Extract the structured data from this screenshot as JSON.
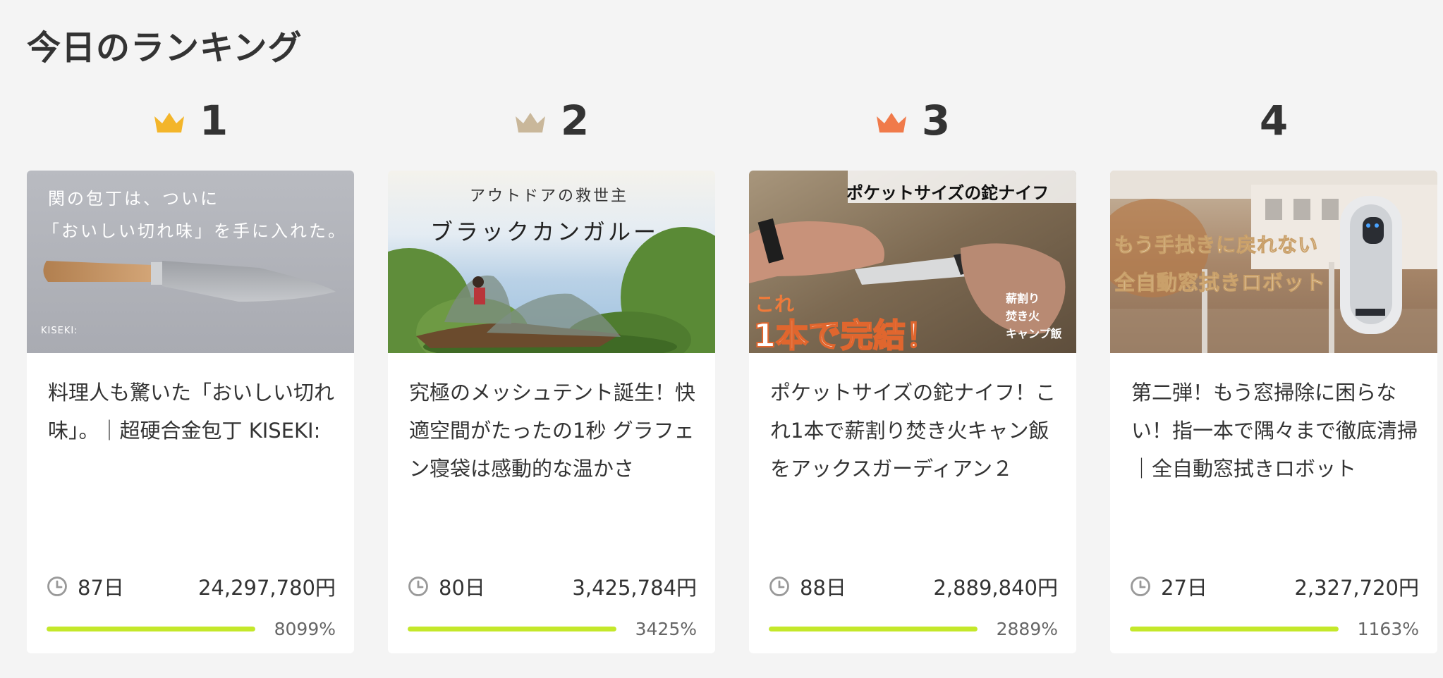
{
  "section_title": "今日のランキング",
  "colors": {
    "gold": "#f3b52a",
    "silver": "#c9b79a",
    "bronze": "#f07a4a",
    "progress": "#c4e82a"
  },
  "rankings": [
    {
      "rank": "1",
      "crown_color": "#f3b52a",
      "thumb": {
        "line1": "関の包丁は、ついに",
        "line2": "「おいしい切れ味」を手に入れた。",
        "brand": "KISEKI:"
      },
      "title": "料理人も驚いた「おいしい切れ味」。｜超硬合金包丁 KISEKI:",
      "days": "87日",
      "amount": "24,297,780円",
      "percent": "8099%",
      "progress_fraction": 1.0
    },
    {
      "rank": "2",
      "crown_color": "#c9b79a",
      "thumb": {
        "line1": "アウトドアの救世主",
        "line2": "ブラックカンガルー"
      },
      "title": "究極のメッシュテント誕生！快適空間がたったの1秒 グラフェン寝袋は感動的な温かさ",
      "days": "80日",
      "amount": "3,425,784円",
      "percent": "3425%",
      "progress_fraction": 1.0
    },
    {
      "rank": "3",
      "crown_color": "#f07a4a",
      "thumb": {
        "line1": "ポケットサイズの鉈ナイフ",
        "line2": "これ",
        "line3": "1本で完結！",
        "side1": "薪割り",
        "side2": "焚き火",
        "side3": "キャンプ飯"
      },
      "title": "ポケットサイズの鉈ナイフ！これ1本で薪割り焚き火キャン飯をアックスガーディアン２",
      "days": "88日",
      "amount": "2,889,840円",
      "percent": "2889%",
      "progress_fraction": 1.0
    },
    {
      "rank": "4",
      "crown_color": "",
      "thumb": {
        "line1": "もう手拭きに戻れない",
        "line2": "全自動窓拭きロボット"
      },
      "title": "第二弾！もう窓掃除に困らない！指一本で隅々まで徹底清掃｜全自動窓拭きロボット",
      "days": "27日",
      "amount": "2,327,720円",
      "percent": "1163%",
      "progress_fraction": 1.0
    }
  ]
}
